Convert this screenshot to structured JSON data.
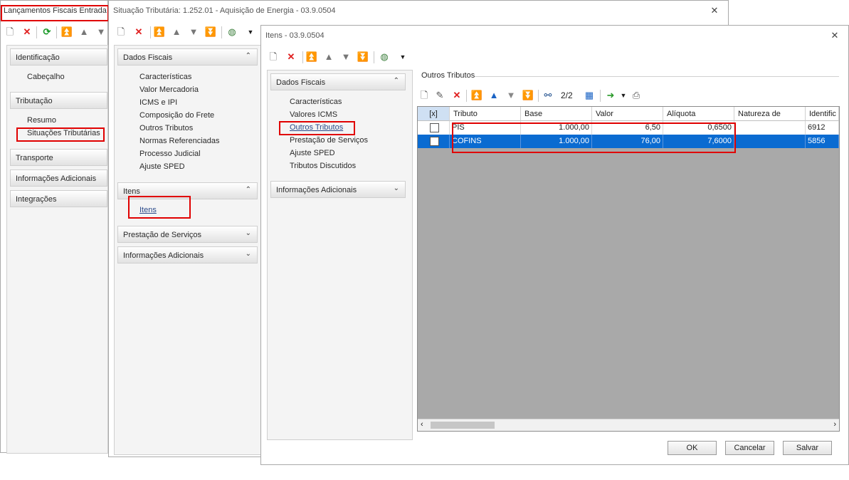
{
  "win1": {
    "title": "Lançamentos Fiscais Entrada :",
    "groups": [
      {
        "label": "Identificação",
        "items": [
          "Cabeçalho"
        ]
      },
      {
        "label": "Tributação",
        "items": [
          "Resumo",
          "Situações Tributárias"
        ]
      },
      {
        "label": "Transporte"
      },
      {
        "label": "Informações Adicionais"
      },
      {
        "label": "Integrações"
      }
    ]
  },
  "win2": {
    "title": "Situação Tributária: 1.252.01 - Aquisição de Energia - 03.9.0504",
    "groups": [
      {
        "label": "Dados Fiscais",
        "items": [
          "Características",
          "Valor Mercadoria",
          "ICMS e IPI",
          "Composição do Frete",
          "Outros Tributos",
          "Normas Referenciadas",
          "Processo Judicial",
          "Ajuste SPED"
        ]
      },
      {
        "label": "Itens",
        "items": [
          "Itens"
        ]
      },
      {
        "label": "Prestação de Serviços"
      },
      {
        "label": "Informações Adicionais"
      }
    ]
  },
  "win3": {
    "title": "Itens - 03.9.0504",
    "groups": [
      {
        "label": "Dados Fiscais",
        "items": [
          "Características",
          "Valores ICMS",
          "Outros Tributos",
          "Prestação de Serviços",
          "Ajuste SPED",
          "Tributos Discutidos"
        ]
      },
      {
        "label": "Informações Adicionais"
      }
    ],
    "section_title": "Outros Tributos",
    "record_counter": "2/2",
    "grid": {
      "columns": [
        "[x]",
        "Tributo",
        "Base",
        "Valor",
        "Alíquota",
        "Natureza de",
        "Identific"
      ],
      "rows": [
        {
          "tributo": "PIS",
          "base": "1.000,00",
          "valor": "6,50",
          "aliquota": "0,6500",
          "natureza": "",
          "ident": "6912",
          "selected": false
        },
        {
          "tributo": "COFINS",
          "base": "1.000,00",
          "valor": "76,00",
          "aliquota": "7,6000",
          "natureza": "",
          "ident": "5856",
          "selected": true
        }
      ]
    },
    "buttons": {
      "ok": "OK",
      "cancel": "Cancelar",
      "save": "Salvar"
    }
  },
  "colors": {
    "highlight_red": "#e00000",
    "selection_blue": "#0a6bd1",
    "grid_empty": "#a9a9a9"
  }
}
